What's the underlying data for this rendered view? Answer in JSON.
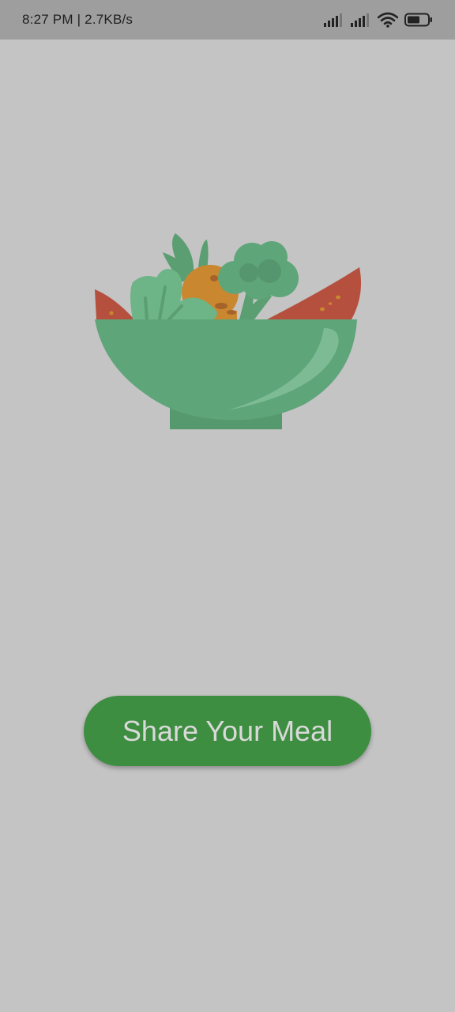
{
  "status_bar": {
    "time_speed": "8:27 PM | 2.7KB/s",
    "icons": [
      "signal-icon",
      "signal-icon",
      "wifi-icon",
      "battery-icon"
    ]
  },
  "illustration": {
    "icon": "salad-bowl-illustration"
  },
  "cta": {
    "label": "Share Your Meal"
  },
  "colors": {
    "background": "#c4c4c4",
    "status_bar": "#9e9e9e",
    "button": "#3e8e41",
    "button_text": "#d9d9d9",
    "bowl": "#5fa57a"
  }
}
